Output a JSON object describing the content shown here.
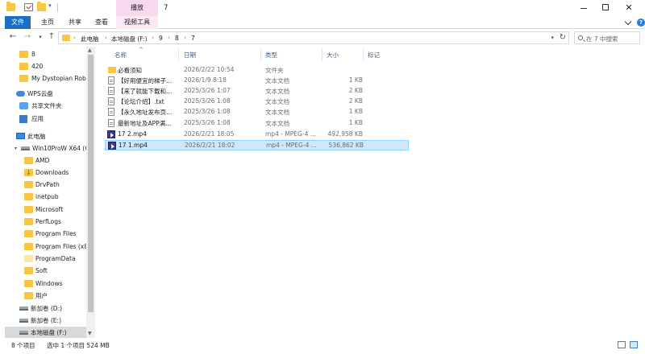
{
  "window": {
    "title": "7",
    "context_tab_header": "播放"
  },
  "ribbon": {
    "tabs": [
      {
        "label": "文件"
      },
      {
        "label": "主页"
      },
      {
        "label": "共享"
      },
      {
        "label": "查看"
      },
      {
        "label": "视频工具"
      }
    ]
  },
  "address": {
    "crumbs": [
      "此电脑",
      "本地磁盘 (F:)",
      "9",
      "8",
      "7"
    ],
    "search_placeholder": "在 7 中搜索"
  },
  "nav": {
    "items": [
      {
        "label": "8",
        "icon": "folder-icon"
      },
      {
        "label": "420",
        "icon": "folder-icon"
      },
      {
        "label": "My Dystopian Rob",
        "icon": "folder-icon"
      },
      {
        "label": "WPS云盘",
        "icon": "cloud-icon"
      },
      {
        "label": "共享文件夹",
        "icon": "share-folder-icon"
      },
      {
        "label": "应用",
        "icon": "apps-icon"
      },
      {
        "label": "此电脑",
        "icon": "computer-icon"
      },
      {
        "label": "Win10ProW X64 (C",
        "icon": "drive-icon"
      },
      {
        "label": "AMD",
        "icon": "folder-icon"
      },
      {
        "label": "Downloads",
        "icon": "downloads-folder-icon"
      },
      {
        "label": "DrvPath",
        "icon": "folder-icon"
      },
      {
        "label": "inetpub",
        "icon": "folder-icon"
      },
      {
        "label": "Microsoft",
        "icon": "folder-icon"
      },
      {
        "label": "PerfLogs",
        "icon": "folder-icon"
      },
      {
        "label": "Program Files",
        "icon": "folder-icon"
      },
      {
        "label": "Program Files (x8",
        "icon": "folder-icon"
      },
      {
        "label": "ProgramData",
        "icon": "folder-icon"
      },
      {
        "label": "Soft",
        "icon": "folder-icon"
      },
      {
        "label": "Windows",
        "icon": "folder-icon"
      },
      {
        "label": "用户",
        "icon": "folder-icon"
      },
      {
        "label": "新加卷 (D:)",
        "icon": "drive-icon"
      },
      {
        "label": "新加卷 (E:)",
        "icon": "drive-icon"
      },
      {
        "label": "本地磁盘 (F:)",
        "icon": "drive-icon"
      }
    ]
  },
  "columns": {
    "name": "名称",
    "date": "日期",
    "type": "类型",
    "size": "大小",
    "tags": "标记"
  },
  "files": [
    {
      "name": "必看须知",
      "date": "2026/2/22 10:54",
      "type": "文件夹",
      "size": "",
      "icon": "folder-icon"
    },
    {
      "name": "【好用便宜的梯子...",
      "date": "2026/1/9 8:18",
      "type": "文本文档",
      "size": "1 KB",
      "icon": "text-file-icon"
    },
    {
      "name": "【来了就能下载和...",
      "date": "2025/3/26 1:07",
      "type": "文本文档",
      "size": "2 KB",
      "icon": "text-file-icon"
    },
    {
      "name": "【论坛介绍】.txt",
      "date": "2025/3/26 1:08",
      "type": "文本文档",
      "size": "2 KB",
      "icon": "text-file-icon"
    },
    {
      "name": "【永久地址发布页...",
      "date": "2025/3/26 1:08",
      "type": "文本文档",
      "size": "1 KB",
      "icon": "text-file-icon"
    },
    {
      "name": "最新地址及APP满...",
      "date": "2025/3/26 1:08",
      "type": "文本文档",
      "size": "1 KB",
      "icon": "text-file-icon"
    },
    {
      "name": "17 2.mp4",
      "date": "2026/2/21 18:05",
      "type": "mp4 - MPEG-4 ...",
      "size": "492,958 KB",
      "icon": "video-file-icon"
    },
    {
      "name": "17 1.mp4",
      "date": "2026/2/21 18:02",
      "type": "mp4 - MPEG-4 ...",
      "size": "536,862 KB",
      "icon": "video-file-icon",
      "selected": true
    }
  ],
  "status": {
    "item_count": "8 个项目",
    "selection": "选中 1 个项目  524 MB"
  },
  "colors": {
    "file_tab": "#1a6fc4",
    "context_tab": "#f7d8ef",
    "selection": "#cce8ff"
  }
}
